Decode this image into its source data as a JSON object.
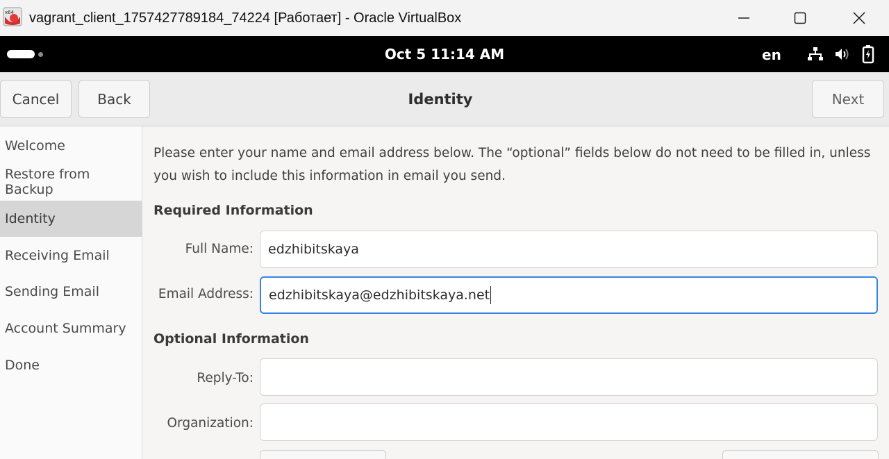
{
  "window": {
    "title": "vagrant_client_1757427789184_74224 [Работает] - Oracle VirtualBox",
    "icon_badge": "x64",
    "controls": [
      "minimize-icon",
      "maximize-icon",
      "close-icon"
    ]
  },
  "topbar": {
    "clock": "Oct 5  11:14 AM",
    "language": "en",
    "tray_icons": [
      "network-icon",
      "volume-icon",
      "battery-icon"
    ]
  },
  "header": {
    "cancel": "Cancel",
    "back": "Back",
    "title": "Identity",
    "next": "Next"
  },
  "sidebar": {
    "items": [
      {
        "label": "Welcome"
      },
      {
        "label": "Restore from Backup"
      },
      {
        "label": "Identity",
        "active": true
      },
      {
        "label": "Receiving Email"
      },
      {
        "label": "Sending Email"
      },
      {
        "label": "Account Summary"
      },
      {
        "label": "Done"
      }
    ]
  },
  "form": {
    "intro": "Please enter your name and email address below. The “optional” fields below do not need to be filled in, unless you wish to include this information in email you send.",
    "required_heading": "Required Information",
    "full_name_label": "Full Name:",
    "full_name_value": "edzhibitskaya",
    "email_label": "Email Address:",
    "email_value": "edzhibitskaya@edzhibitskaya.net",
    "optional_heading": "Optional Information",
    "reply_to_label": "Reply-To:",
    "reply_to_value": "",
    "organization_label": "Organization:",
    "organization_value": ""
  },
  "colors": {
    "focus_accent": "#3584e4",
    "gnome_bar": "#000000",
    "sidebar_active": "#d6d6d6"
  }
}
